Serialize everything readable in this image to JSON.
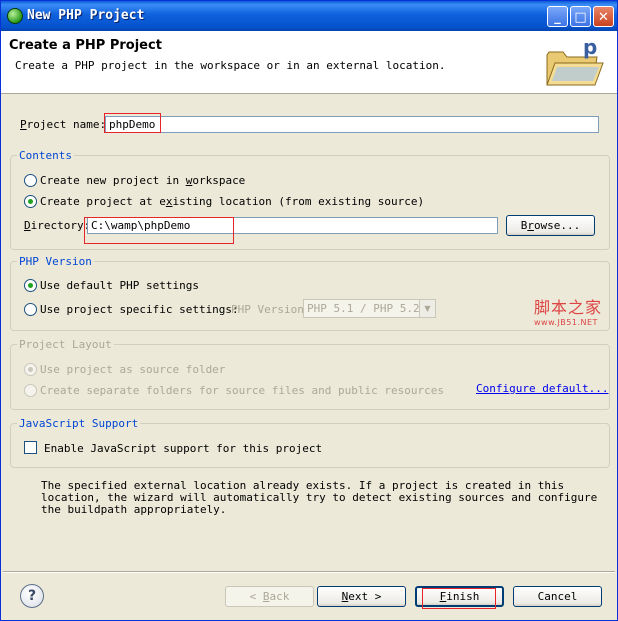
{
  "window": {
    "title": "New PHP Project"
  },
  "header": {
    "title": "Create a PHP Project",
    "description": "Create a PHP project in the workspace or in an external location."
  },
  "project_name": {
    "label": "Project name:",
    "value": "phpDemo"
  },
  "contents": {
    "title": "Contents",
    "options": [
      "Create new project in workspace",
      "Create project at existing location (from existing source)"
    ],
    "selected": 1,
    "directory_label": "Directory:",
    "directory_value": "C:\\wamp\\phpDemo",
    "browse_label": "Browse..."
  },
  "php_version": {
    "title": "PHP Version",
    "options": [
      "Use default PHP settings",
      "Use project specific settings:"
    ],
    "selected": 0,
    "version_label": "PHP Version:",
    "version_value": "PHP 5.1 / PHP 5.2"
  },
  "project_layout": {
    "title": "Project Layout",
    "options": [
      "Use project as source folder",
      "Create separate folders for source files and public resources"
    ],
    "selected": 0,
    "configure_link": "Configure default..."
  },
  "javascript": {
    "title": "JavaScript Support",
    "checkbox_label": "Enable JavaScript support for this project",
    "checked": false
  },
  "message": "The specified external location already exists. If a project is created in this location, the wizard will automatically try to detect existing sources and configure the buildpath appropriately.",
  "watermark": {
    "line1": "脚本之家",
    "line2": "www.JB51.NET"
  },
  "buttons": {
    "back": "< Back",
    "next": "Next >",
    "finish": "Finish",
    "cancel": "Cancel"
  },
  "colors": {
    "titlebar": "#0a5bd6",
    "highlight": "#e8242a",
    "group_title": "#0046d5",
    "link": "#0000ee"
  }
}
